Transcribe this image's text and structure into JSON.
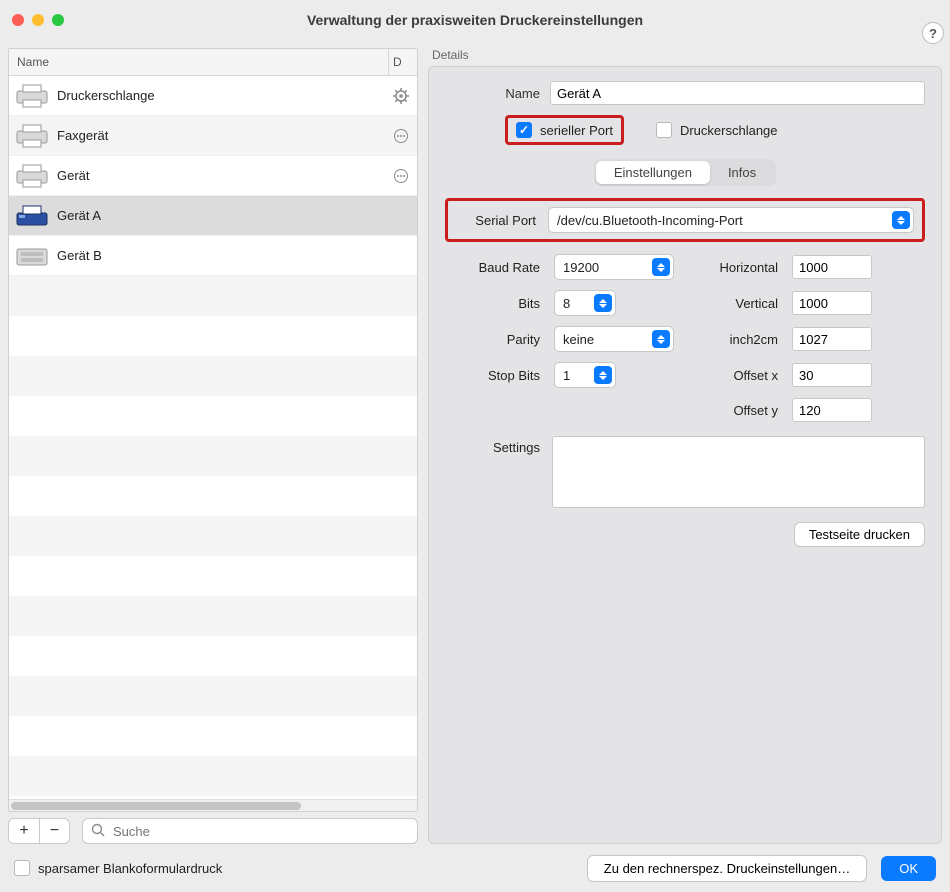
{
  "window": {
    "title": "Verwaltung der praxisweiten Druckereinstellungen"
  },
  "list": {
    "headers": {
      "name": "Name",
      "d": "D"
    },
    "items": [
      {
        "label": "Druckerschlange",
        "icon": "printer",
        "action": "gear"
      },
      {
        "label": "Faxgerät",
        "icon": "printer",
        "action": "more"
      },
      {
        "label": "Gerät",
        "icon": "printer",
        "action": "more"
      },
      {
        "label": "Gerät A",
        "icon": "printer-blue",
        "action": "",
        "selected": true
      },
      {
        "label": "Gerät B",
        "icon": "printer",
        "action": ""
      }
    ],
    "search_placeholder": "Suche"
  },
  "details": {
    "section_label": "Details",
    "name_label": "Name",
    "name_value": "Gerät A",
    "serial_check_label": "serieller Port",
    "queue_check_label": "Druckerschlange",
    "tabs": {
      "settings": "Einstellungen",
      "infos": "Infos"
    },
    "serial_port_label": "Serial Port",
    "serial_port_value": "/dev/cu.Bluetooth-Incoming-Port",
    "baud_label": "Baud Rate",
    "baud_value": "19200",
    "bits_label": "Bits",
    "bits_value": "8",
    "parity_label": "Parity",
    "parity_value": "keine",
    "stop_label": "Stop Bits",
    "stop_value": "1",
    "horizontal_label": "Horizontal",
    "horizontal_value": "1000",
    "vertical_label": "Vertical",
    "vertical_value": "1000",
    "inch2cm_label": "inch2cm",
    "inch2cm_value": "1027",
    "offsetx_label": "Offset x",
    "offsetx_value": "30",
    "offsety_label": "Offset y",
    "offsety_value": "120",
    "settings_label": "Settings",
    "settings_value": "",
    "testprint": "Testseite drucken"
  },
  "footer": {
    "blank_label": "sparsamer Blankoformulardruck",
    "computer_settings": "Zu den rechnerspez. Druckeinstellungen…",
    "ok": "OK"
  }
}
